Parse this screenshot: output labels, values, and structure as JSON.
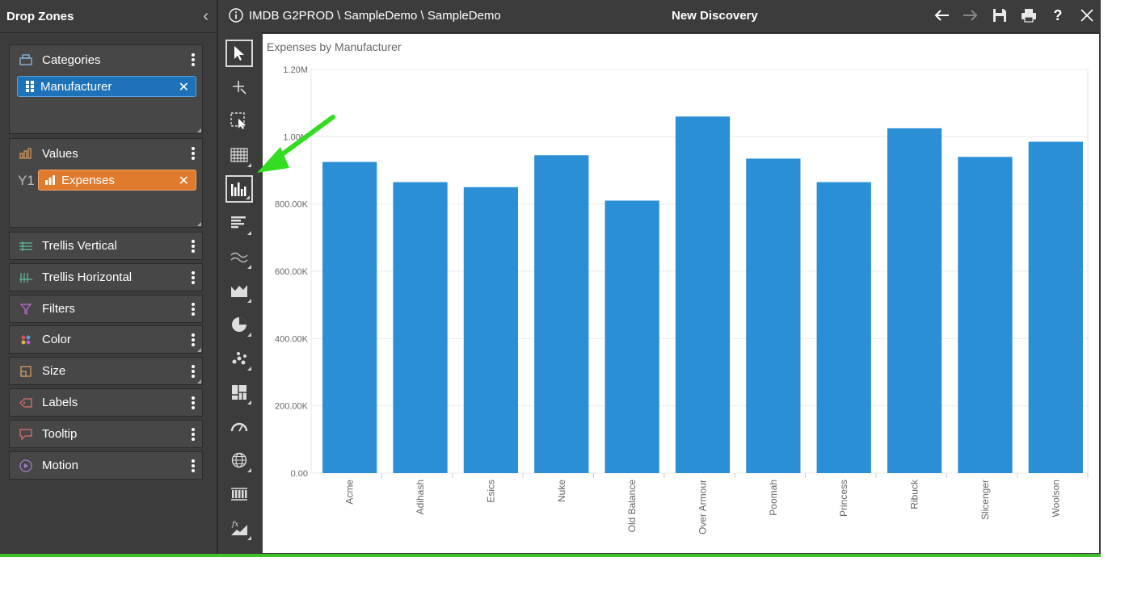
{
  "drop_zones": {
    "title": "Drop Zones",
    "categories": {
      "label": "Categories",
      "pill": "Manufacturer"
    },
    "values": {
      "label": "Values",
      "axis_tag": "Y1",
      "pill": "Expenses"
    },
    "others": [
      {
        "label": "Trellis Vertical",
        "icon": "trellis-vertical-icon"
      },
      {
        "label": "Trellis Horizontal",
        "icon": "trellis-horizontal-icon"
      },
      {
        "label": "Filters",
        "icon": "filter-icon"
      },
      {
        "label": "Color",
        "icon": "color-icon"
      },
      {
        "label": "Size",
        "icon": "size-icon"
      },
      {
        "label": "Labels",
        "icon": "label-icon"
      },
      {
        "label": "Tooltip",
        "icon": "tooltip-icon"
      },
      {
        "label": "Motion",
        "icon": "motion-icon"
      }
    ]
  },
  "header": {
    "breadcrumb": "IMDB G2PROD \\ SampleDemo \\ SampleDemo",
    "title": "New Discovery"
  },
  "chart_data": {
    "type": "bar",
    "title": "Expenses by Manufacturer",
    "categories": [
      "Acme",
      "Adihash",
      "Esics",
      "Nuke",
      "Old Balance",
      "Over Armour",
      "Poomah",
      "Princess",
      "Ribuck",
      "Slicenger",
      "Woolson"
    ],
    "values": [
      925000,
      865000,
      850000,
      945000,
      810000,
      1060000,
      935000,
      865000,
      1025000,
      940000,
      985000
    ],
    "ylim": [
      0,
      1200000
    ],
    "yticks": [
      {
        "value": 0,
        "label": "0.00"
      },
      {
        "value": 200000,
        "label": "200.00K"
      },
      {
        "value": 400000,
        "label": "400.00K"
      },
      {
        "value": 600000,
        "label": "600.00K"
      },
      {
        "value": 800000,
        "label": "800.00K"
      },
      {
        "value": 1000000,
        "label": "1.00M"
      },
      {
        "value": 1200000,
        "label": "1.20M"
      }
    ],
    "bar_color": "#2b8fd6",
    "grid": true
  },
  "colors": {
    "accent_green": "#3fbf2a",
    "pill_blue": "#1e73b8",
    "pill_orange": "#e07b2e"
  }
}
